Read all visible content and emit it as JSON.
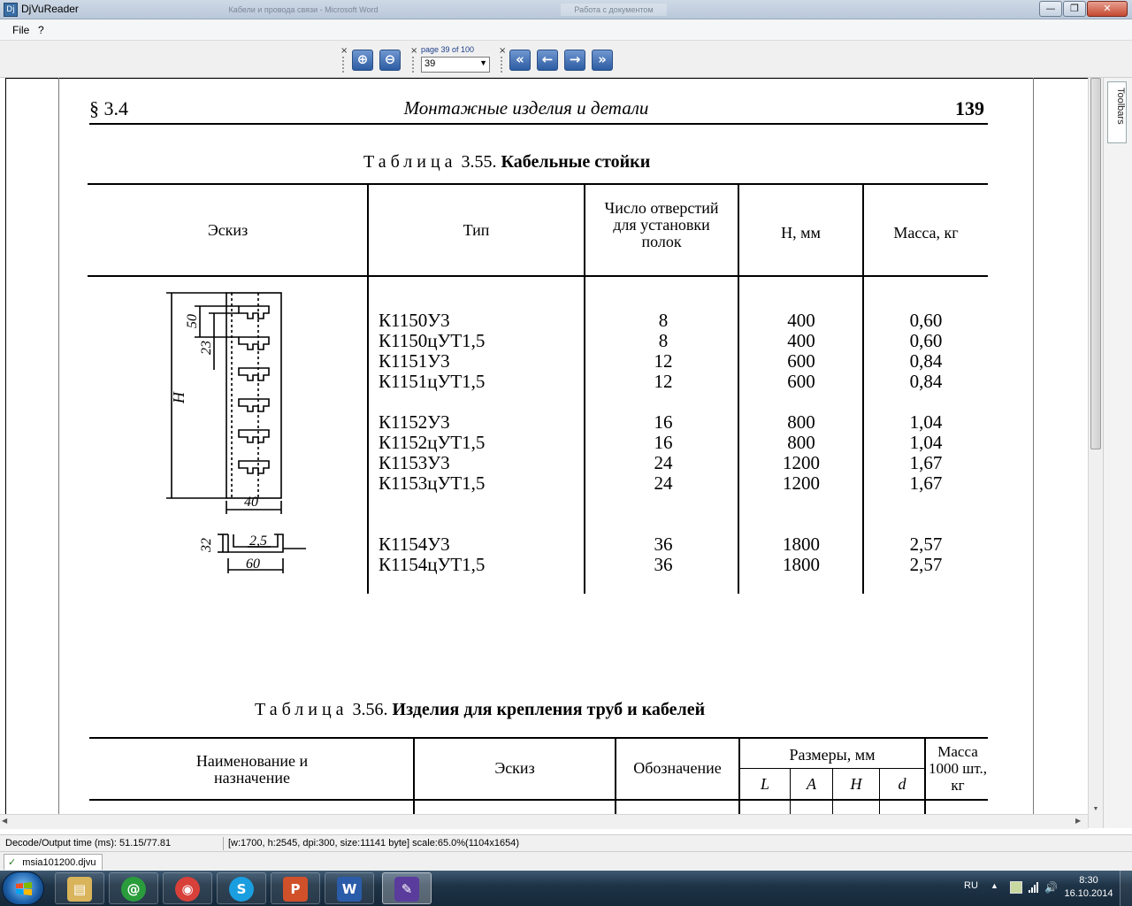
{
  "window": {
    "title": "DjVuReader",
    "ghost_tab_1": "Кабели и провода связи - Microsoft Word",
    "ghost_tab_2": "Работа с документом",
    "min_glyph": "—",
    "max_glyph": "❐",
    "close_glyph": "✕"
  },
  "menu": {
    "file": "File",
    "help": "?"
  },
  "toolbar": {
    "zoom_in_glyph": "⊕",
    "zoom_out_glyph": "⊖",
    "page_label": "page 39 of 100",
    "page_value": "39",
    "first_glyph": "«",
    "prev_glyph": "←",
    "next_glyph": "→",
    "last_glyph": "»",
    "close_x": "×"
  },
  "page": {
    "section": "§ 3.4",
    "title": "Монтажные изделия и детали",
    "number": "139"
  },
  "table355": {
    "caption_prefix": "Таблица",
    "caption_number": "3.55.",
    "caption_title": "Кабельные стойки",
    "headers": {
      "sketch": "Эскиз",
      "type": "Тип",
      "holes": "Число отверстий для установки полок",
      "h": "H, мм",
      "mass": "Масса, кг"
    },
    "sketch_labels": {
      "d50": "50",
      "d23": "23",
      "dH": "H",
      "d40": "40",
      "d32": "32",
      "d25": "2,5",
      "d60": "60"
    },
    "types": [
      "К1150У3",
      "К1150цУТ1,5",
      "К1151У3",
      "К1151цУТ1,5",
      "",
      "К1152У3",
      "К1152цУТ1,5",
      "К1153У3",
      "К1153цУТ1,5",
      "",
      "",
      "К1154У3",
      "К1154цУТ1,5"
    ],
    "holes": [
      "8",
      "8",
      "12",
      "12",
      "",
      "16",
      "16",
      "24",
      "24",
      "",
      "",
      "36",
      "36"
    ],
    "h": [
      "400",
      "400",
      "600",
      "600",
      "",
      "800",
      "800",
      "1200",
      "1200",
      "",
      "",
      "1800",
      "1800"
    ],
    "mass": [
      "0,60",
      "0,60",
      "0,84",
      "0,84",
      "",
      "1,04",
      "1,04",
      "1,67",
      "1,67",
      "",
      "",
      "2,57",
      "2,57"
    ]
  },
  "table356": {
    "caption_prefix": "Таблица",
    "caption_number": "3.56.",
    "caption_title": "Изделия для крепления труб и кабелей",
    "headers": {
      "name": "Наименование и назначение",
      "sketch": "Эскиз",
      "designation": "Обозначение",
      "dims": "Размеры, мм",
      "L": "L",
      "A": "A",
      "H": "H",
      "d": "d",
      "mass": "Масса 1000 шт., кг"
    }
  },
  "side_toolbar": {
    "label": "Toolbars"
  },
  "status": {
    "decode": "Decode/Output time (ms): 51.15/77.81",
    "info": "[w:1700, h:2545, dpi:300, size:11141 byte] scale:65.0%(1104x1654)"
  },
  "doc_tab": {
    "check": "✓",
    "name": "msia101200.djvu"
  },
  "taskbar": {
    "apps": [
      {
        "name": "file-explorer",
        "glyph": "▤",
        "color": "#d9b45a"
      },
      {
        "name": "mail-agent",
        "glyph": "@",
        "color": "#2a9c3c"
      },
      {
        "name": "chrome",
        "glyph": "◉",
        "color": "#d8403a"
      },
      {
        "name": "skype",
        "glyph": "S",
        "color": "#1a9ee0"
      },
      {
        "name": "powerpoint-viewer",
        "glyph": "P",
        "color": "#d0502a"
      },
      {
        "name": "word",
        "glyph": "W",
        "color": "#2b5caa"
      },
      {
        "name": "djvureader",
        "glyph": "✎",
        "color": "#5a3c9c"
      }
    ],
    "lang": "RU",
    "tray_arrow": "▲",
    "volume_glyph": "🔊",
    "time": "8:30",
    "date": "16.10.2014"
  }
}
